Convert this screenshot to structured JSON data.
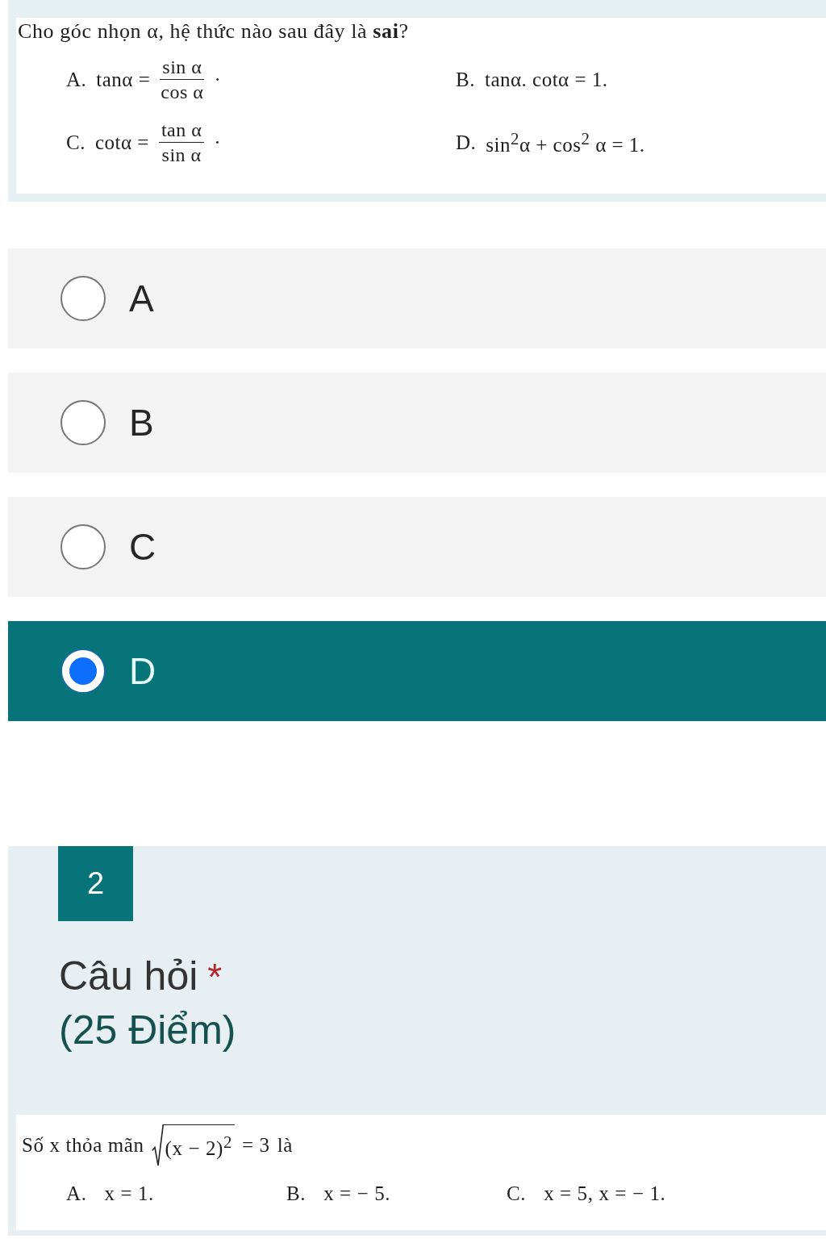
{
  "question_1": {
    "document": {
      "prompt": "Cho góc nhọn α, hệ thức nào sau đây là **sai**?",
      "choices": [
        {
          "label": "A.",
          "parts": [
            {
              "kind": "text",
              "text": "tanα ="
            },
            {
              "kind": "frac",
              "numerator": "sin α",
              "denominator": "cos α"
            },
            {
              "kind": "text",
              "text": "·"
            }
          ]
        },
        {
          "label": "B.",
          "parts": [
            {
              "kind": "text",
              "text": "tanα. cotα = 1."
            }
          ]
        },
        {
          "label": "C.",
          "parts": [
            {
              "kind": "text",
              "text": "cotα ="
            },
            {
              "kind": "frac",
              "numerator": "tan α",
              "denominator": "sin α"
            },
            {
              "kind": "text",
              "text": "·"
            }
          ]
        },
        {
          "label": "D.",
          "parts": [
            {
              "kind": "text",
              "text": "sin$^{2}$α + cos$^{2}$ α = 1."
            }
          ]
        }
      ]
    },
    "options": [
      {
        "label": "A",
        "selected": false
      },
      {
        "label": "B",
        "selected": false
      },
      {
        "label": "C",
        "selected": false
      },
      {
        "label": "D",
        "selected": true
      }
    ]
  },
  "question_2": {
    "number": "2",
    "title": "Câu hỏi",
    "required_mark": "*",
    "points": "(25 Điểm)",
    "document": {
      "prompt_parts": [
        {
          "kind": "text",
          "text": "Số x thỏa mãn"
        },
        {
          "kind": "sqrt",
          "radicand": "(x − 2)$^{2}$"
        },
        {
          "kind": "text",
          "text": "= 3"
        },
        {
          "kind": "text",
          "text": "là"
        }
      ],
      "choices": [
        {
          "label": "A.",
          "parts": [
            {
              "kind": "text",
              "text": "x = 1."
            }
          ]
        },
        {
          "label": "B.",
          "parts": [
            {
              "kind": "text",
              "text": "x = − 5."
            }
          ]
        },
        {
          "label": "C.",
          "parts": [
            {
              "kind": "text",
              "text": "x = 5, x = − 1."
            }
          ]
        }
      ]
    }
  }
}
